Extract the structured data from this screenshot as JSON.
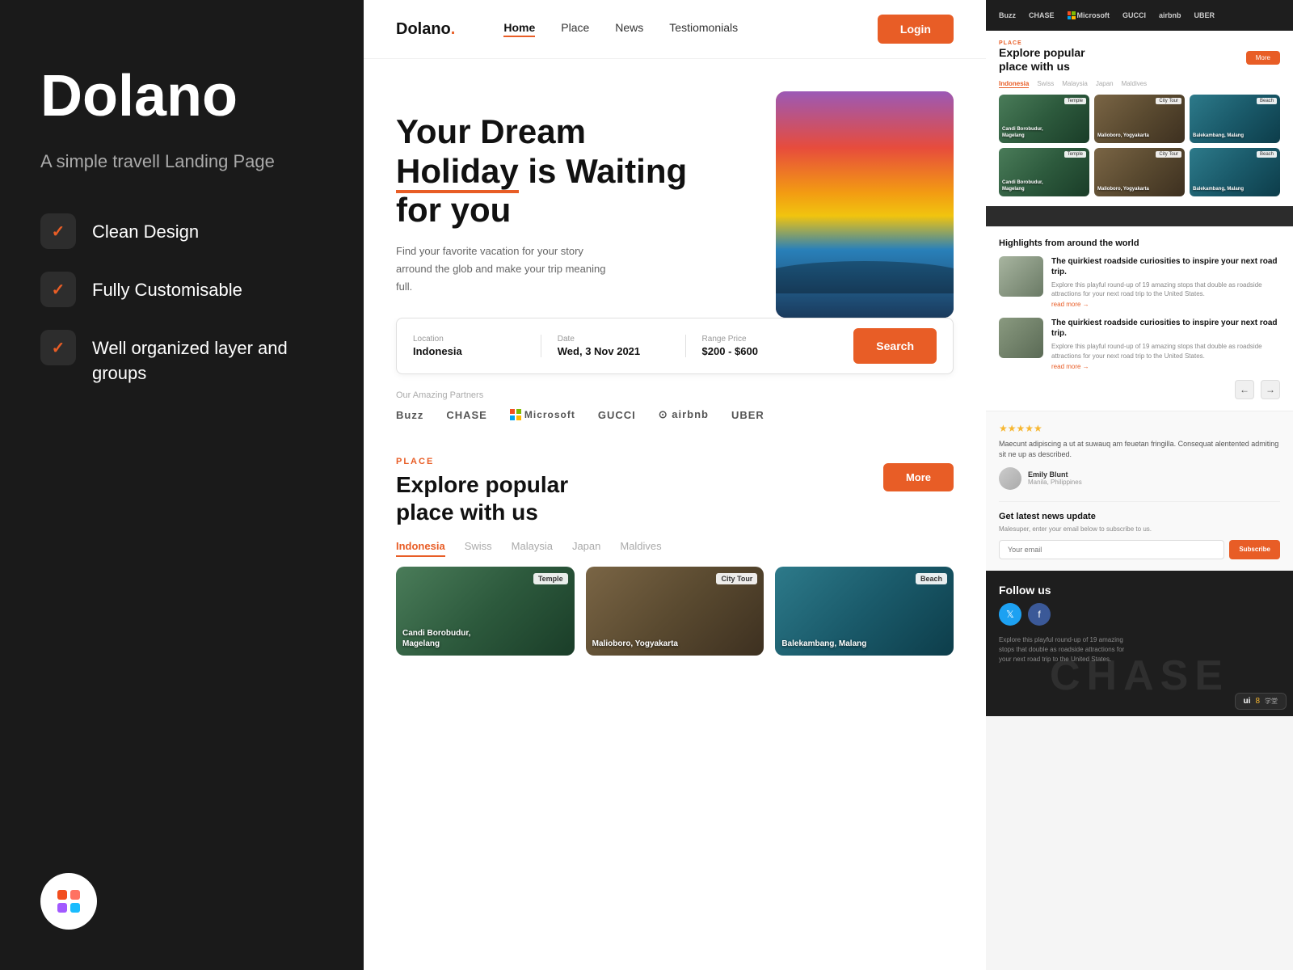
{
  "left": {
    "title": "Dolano",
    "subtitle": "A simple travell Landing Page",
    "features": [
      {
        "label": "Clean Design"
      },
      {
        "label": "Fully Customisable"
      },
      {
        "label": "Well organized layer and groups"
      }
    ]
  },
  "site": {
    "logo": "Dolano",
    "logo_dot": ".",
    "nav": [
      {
        "label": "Home",
        "active": true
      },
      {
        "label": "Place"
      },
      {
        "label": "News"
      },
      {
        "label": "Testiomonials"
      }
    ],
    "login_btn": "Login",
    "hero": {
      "title_line1": "Your Dream",
      "title_highlight": "Holiday",
      "title_line2": "is Waiting",
      "title_line3": "for you",
      "description": "Find your favorite vacation for your story arround the glob and make your trip meaning full."
    },
    "search": {
      "location_label": "Location",
      "location_value": "Indonesia",
      "date_label": "Date",
      "date_value": "Wed, 3 Nov 2021",
      "price_label": "Range Price",
      "price_value": "$200 - $600",
      "btn": "Search"
    },
    "partners": {
      "label": "Our Amazing Partners",
      "logos": [
        "Buzz",
        "CHASE",
        "Microsoft",
        "GUCCI",
        "airbnb",
        "UBER"
      ]
    },
    "place_section": {
      "tag": "PLACE",
      "title_line1": "Explore popular",
      "title_line2": "place with us",
      "more_btn": "More",
      "tabs": [
        "Indonesia",
        "Swiss",
        "Malaysia",
        "Japan",
        "Maldives"
      ],
      "active_tab": "Indonesia",
      "cards": [
        {
          "tag": "Temple",
          "label": "Candi Borobudur,\nMagelang",
          "bg": 1
        },
        {
          "tag": "City Tour",
          "label": "Malioboro, Yogyakarta",
          "bg": 2
        },
        {
          "tag": "Beach",
          "label": "Balekambang, Malang",
          "bg": 3
        }
      ]
    }
  },
  "right": {
    "top_nav_logos": [
      "Buzz",
      "CHASE",
      "Microsoft",
      "GUCCI",
      "airbnb",
      "UBER"
    ],
    "place": {
      "tag": "PLACE",
      "title_line1": "Explore popular",
      "title_line2": "place with us",
      "more_btn": "More",
      "tabs": [
        "Indonesia",
        "Swiss",
        "Malaysia",
        "Japan",
        "Maldives"
      ],
      "active_tab": "Indonesia",
      "cards": [
        {
          "tag": "Temple",
          "label": "Candi Borobudur,\nMagelang",
          "bg": 1
        },
        {
          "tag": "City Tour",
          "label": "Malioboro, Yogyakarta",
          "bg": 2
        },
        {
          "tag": "Beach",
          "label": "Balekambang, Malang",
          "bg": 3
        },
        {
          "tag": "Temple",
          "label": "Candi Borobudur,\nMagelang",
          "bg": 1
        },
        {
          "tag": "City Tour",
          "label": "Malioboro, Yogyakarta",
          "bg": 2
        },
        {
          "tag": "Beach",
          "label": "Balekambang, Malang",
          "bg": 3
        }
      ]
    },
    "articles": {
      "section_title": "Highlights from around the world",
      "items": [
        {
          "headline": "The quirkiest roadside curiosities to inspire your next road trip.",
          "body": "Explore this playful round-up of 19 amazing stops that double as roadside attractions for your next road trip to the United States.",
          "read_more": "read more →"
        },
        {
          "headline": "The quirkiest roadside curiosities to inspire your next road trip.",
          "body": "Explore this playful round-up of 19 amazing stops that double as roadside attractions for your next road trip to the United States.",
          "read_more": "read more →"
        }
      ]
    },
    "review": {
      "stars": "★★★★★",
      "text": "Maecunt adipiscing a ut at suwauq am feuetan fringilla. Consequat alentented admiting sit ne up as described.",
      "reviewer_name": "Emily Blunt",
      "reviewer_loc": "Manila, Philippines"
    },
    "newsletter": {
      "title": "Get latest news update",
      "desc": "Malesuper, enter your email below to subscribe to us.",
      "input_placeholder": "Your email",
      "btn": "Subscribe"
    },
    "follow": {
      "title": "Follow us",
      "social_labels": [
        "Twitter",
        "Facebook"
      ]
    },
    "chase_watermark": "CHASE",
    "ui8_badge": "ui8",
    "ui8_sub": "学堂"
  }
}
